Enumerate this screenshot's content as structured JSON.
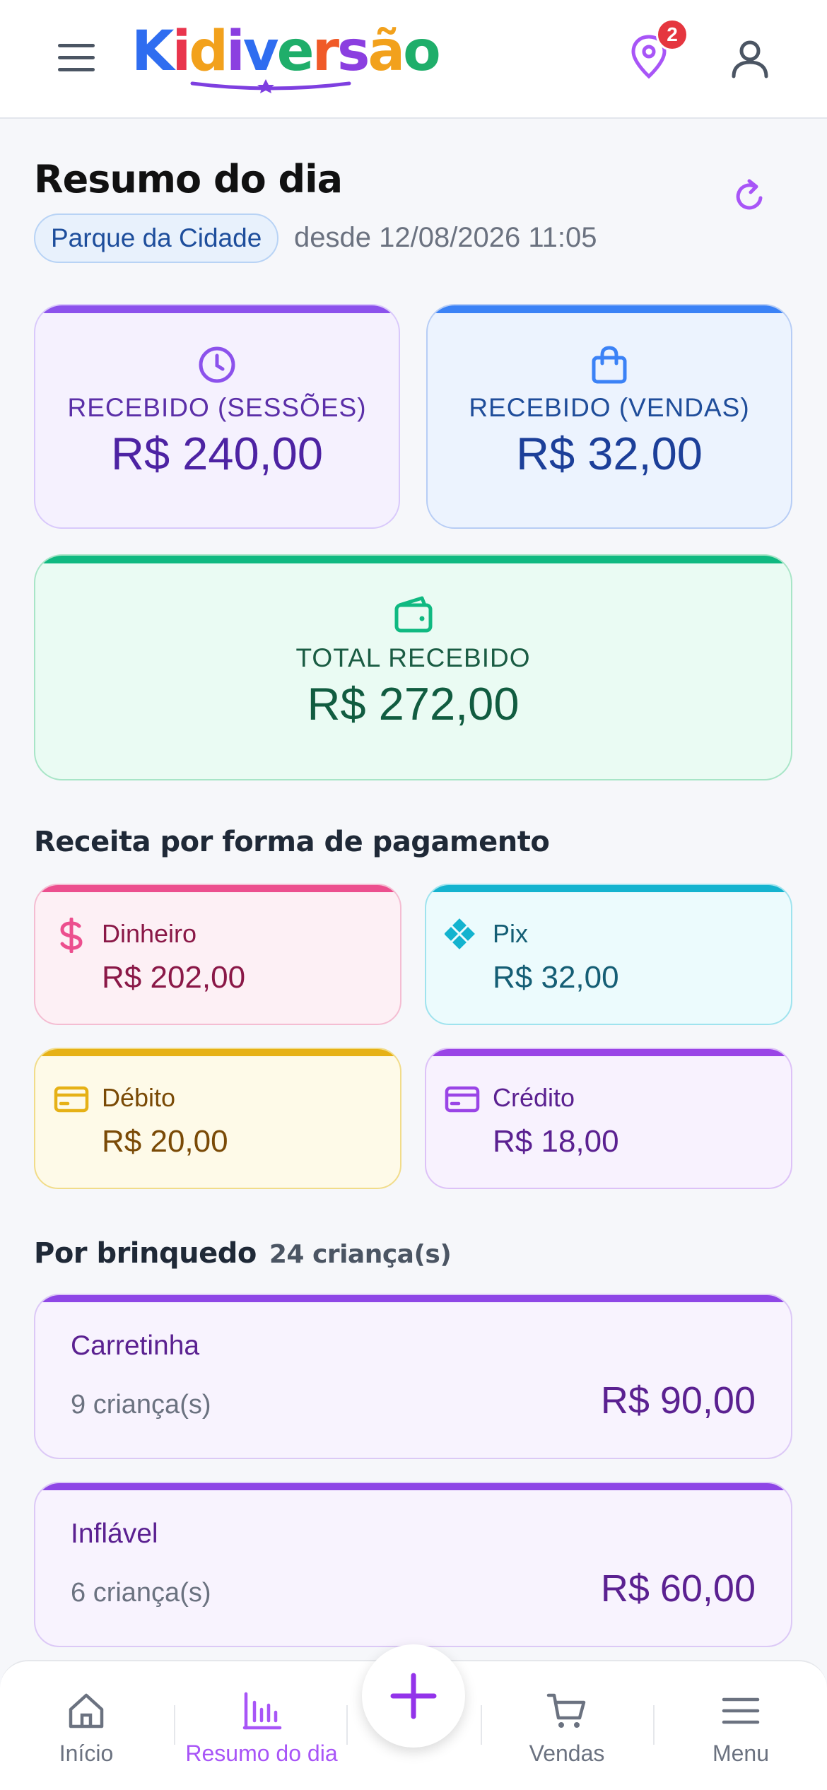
{
  "header": {
    "logo_text": "Kidiversão",
    "notification_count": "2"
  },
  "summary": {
    "title": "Resumo do dia",
    "location": "Parque da Cidade",
    "since": "desde 12/08/2026 11:05"
  },
  "cards": {
    "sessions": {
      "label": "RECEBIDO (SESSÕES)",
      "value": "R$ 240,00",
      "icon": "clock-icon"
    },
    "sales": {
      "label": "RECEBIDO (VENDAS)",
      "value": "R$ 32,00",
      "icon": "shopping-bag-icon"
    },
    "total": {
      "label": "TOTAL RECEBIDO",
      "value": "R$ 272,00",
      "icon": "wallet-icon"
    }
  },
  "payments": {
    "title": "Receita por forma de pagamento",
    "items": [
      {
        "label": "Dinheiro",
        "value": "R$ 202,00",
        "icon": "dollar-icon"
      },
      {
        "label": "Pix",
        "value": "R$ 32,00",
        "icon": "pix-icon"
      },
      {
        "label": "Débito",
        "value": "R$ 20,00",
        "icon": "card-icon"
      },
      {
        "label": "Crédito",
        "value": "R$ 18,00",
        "icon": "card-icon"
      }
    ]
  },
  "toys": {
    "title": "Por brinquedo",
    "count": "24 criança(s)",
    "items": [
      {
        "name": "Carretinha",
        "children": "9 criança(s)",
        "value": "R$ 90,00"
      },
      {
        "name": "Inflável",
        "children": "6 criança(s)",
        "value": "R$ 60,00"
      }
    ]
  },
  "nav": {
    "home": "Início",
    "summary": "Resumo do dia",
    "sales": "Vendas",
    "menu": "Menu"
  },
  "colors": {
    "accent": "#a855f7",
    "sessions": "#8c52ec",
    "sales": "#3b82f6",
    "total": "#10b981"
  }
}
